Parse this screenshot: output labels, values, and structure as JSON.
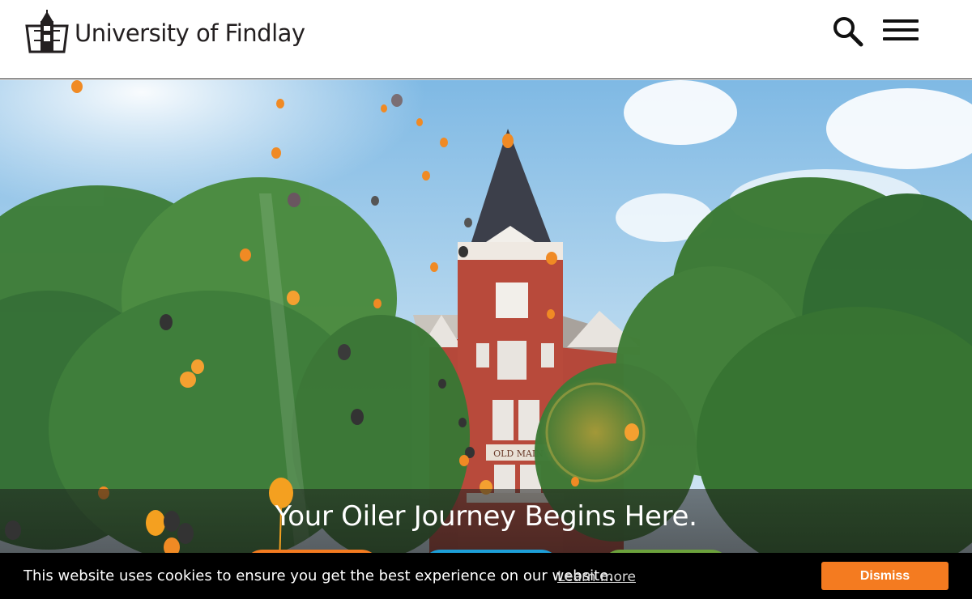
{
  "header": {
    "logo_text": "University of Findlay",
    "logo_icon": "old-main-tower-icon",
    "search_icon": "search-icon",
    "menu_icon": "hamburger-menu-icon"
  },
  "hero": {
    "title": "Your Oiler Journey Begins Here.",
    "building_sign": "OLD MAIN",
    "cta_colors": [
      "#f47b20",
      "#1d9fd8",
      "#6ca23c"
    ]
  },
  "cookie_bar": {
    "message": "This website uses cookies to ensure you get the best experience on our website.",
    "learn_more": "Learn more",
    "dismiss": "Dismiss",
    "accent": "#f47b20"
  }
}
